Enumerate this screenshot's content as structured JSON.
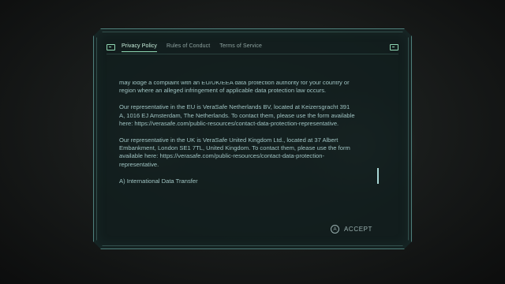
{
  "tabs": [
    {
      "label": "Privacy Policy",
      "active": true
    },
    {
      "label": "Rules of Conduct",
      "active": false
    },
    {
      "label": "Terms of Service",
      "active": false
    }
  ],
  "icons": {
    "left_bumper": "keyboard-icon",
    "right_bumper": "keyboard-icon",
    "accept_button_glyph": "A"
  },
  "content": {
    "paragraphs": [
      "may lodge a complaint with an EU/UK/EEA data protection authority for your country or region where an alleged infringement of applicable data protection law occurs.",
      "Our representative in the EU is VeraSafe Netherlands BV, located at Keizersgracht 391 A, 1016 EJ Amsterdam, The Netherlands. To contact them, please use the form available here: https://verasafe.com/public-resources/contact-data-protection-representative.",
      "Our representative in the UK is VeraSafe United Kingdom Ltd., located at 37 Albert Embankment, London SE1 7TL, United Kingdom. To contact them, please use the form available here: https://verasafe.com/public-resources/contact-data-protection-representative.",
      "A) International Data Transfer"
    ]
  },
  "accept": {
    "label": "ACCEPT"
  },
  "colors": {
    "accent": "#8fd7b3",
    "text": "#9fc3c2",
    "panel_border": "#4f7f7b"
  }
}
